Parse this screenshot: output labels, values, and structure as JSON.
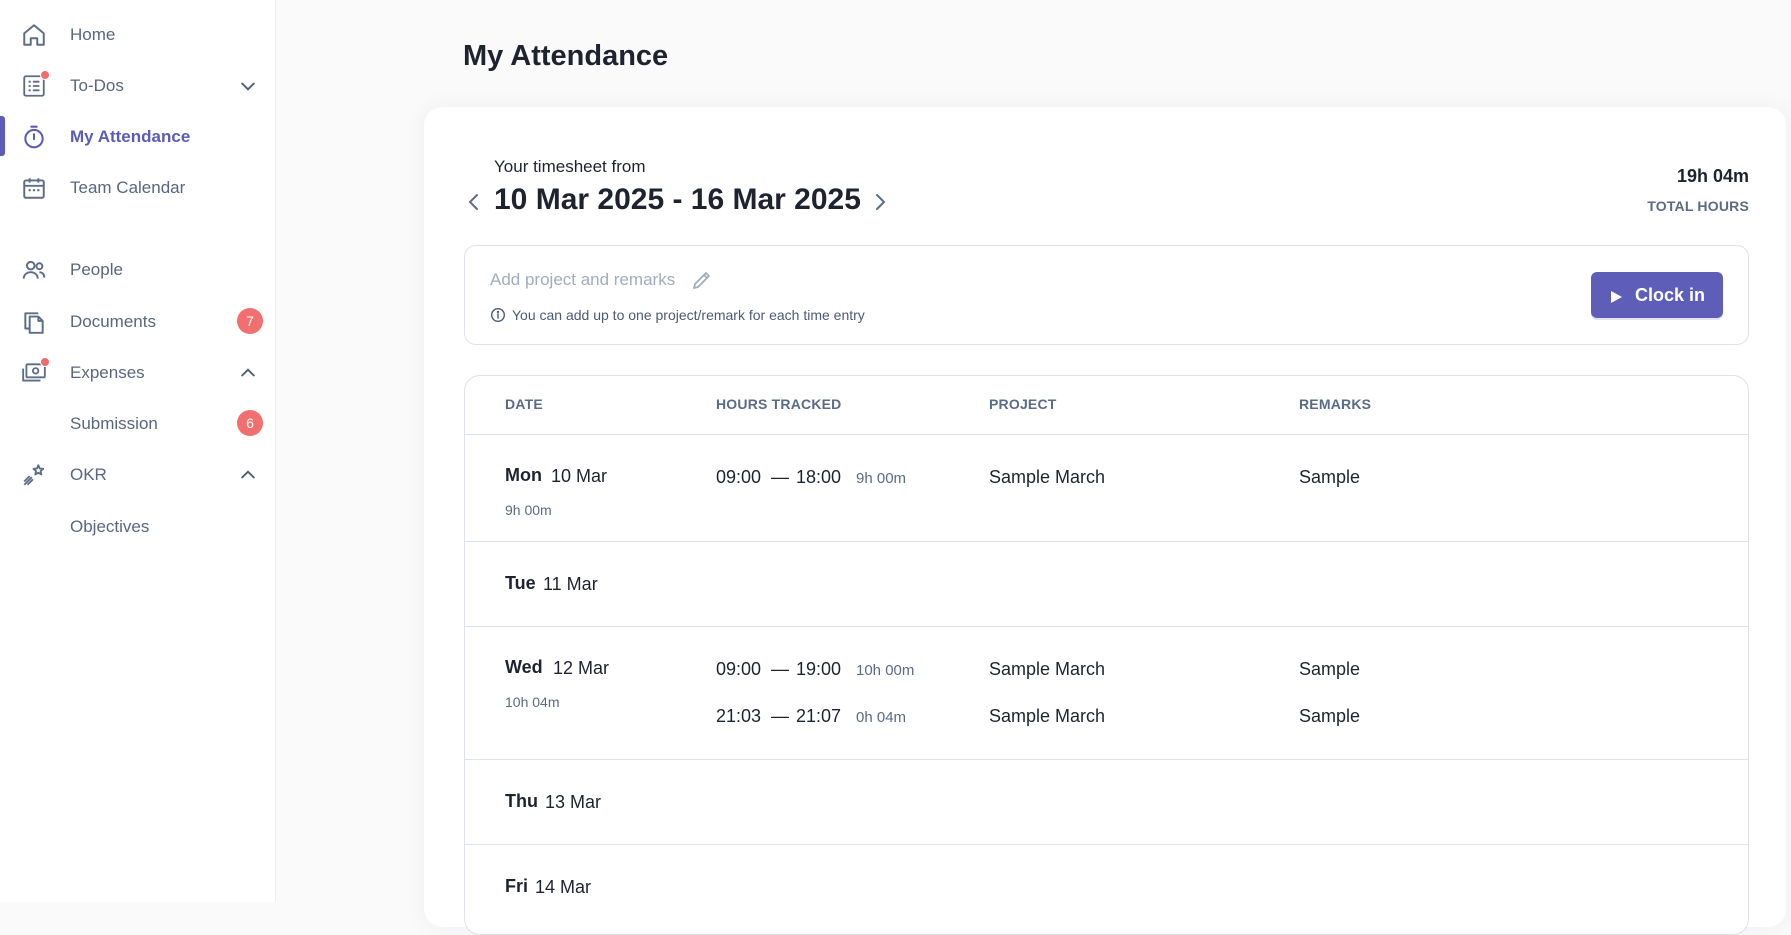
{
  "sidebar": {
    "items": [
      {
        "label": "Home",
        "icon": "home-icon"
      },
      {
        "label": "To-Dos",
        "icon": "todo-list-icon"
      },
      {
        "label": "My Attendance",
        "icon": "stopwatch-icon"
      },
      {
        "label": "Team Calendar",
        "icon": "calendar-icon"
      },
      {
        "label": "People",
        "icon": "people-icon"
      },
      {
        "label": "Documents",
        "icon": "documents-icon",
        "badge": "7"
      },
      {
        "label": "Expenses",
        "icon": "expenses-icon"
      },
      {
        "label": "Submission",
        "badge": "6"
      },
      {
        "label": "OKR",
        "icon": "okr-icon"
      },
      {
        "label": "Objectives"
      }
    ]
  },
  "page": {
    "title": "My Attendance"
  },
  "timesheet": {
    "from_label": "Your timesheet from",
    "range": "10 Mar 2025 - 16 Mar 2025",
    "total_value": "19h 04m",
    "total_label": "TOTAL HOURS"
  },
  "entry": {
    "placeholder": "Add project and remarks",
    "info": "You can add up to one project/remark for each time entry",
    "clock_in_label": "Clock in"
  },
  "table": {
    "headers": {
      "date": "DATE",
      "hours": "HOURS TRACKED",
      "project": "PROJECT",
      "remarks": "REMARKS"
    },
    "rows": [
      {
        "day": "Mon",
        "date": "10 Mar",
        "total": "9h 00m",
        "entries": [
          {
            "start": "09:00",
            "sep": "—",
            "end": "18:00",
            "duration": "9h 00m",
            "project": "Sample March",
            "remarks": "Sample"
          }
        ]
      },
      {
        "day": "Tue",
        "date": "11 Mar",
        "total": "",
        "entries": []
      },
      {
        "day": "Wed",
        "date": "12 Mar",
        "total": "10h 04m",
        "entries": [
          {
            "start": "09:00",
            "sep": "—",
            "end": "19:00",
            "duration": "10h 00m",
            "project": "Sample March",
            "remarks": "Sample"
          },
          {
            "start": "21:03",
            "sep": "—",
            "end": "21:07",
            "duration": "0h 04m",
            "project": "Sample March",
            "remarks": "Sample"
          }
        ]
      },
      {
        "day": "Thu",
        "date": "13 Mar",
        "total": "",
        "entries": []
      },
      {
        "day": "Fri",
        "date": "14 Mar",
        "total": "",
        "entries": []
      }
    ]
  },
  "colors": {
    "accent": "#5e5eb8",
    "badge": "#f26f6f",
    "muted": "#5a6b85"
  }
}
